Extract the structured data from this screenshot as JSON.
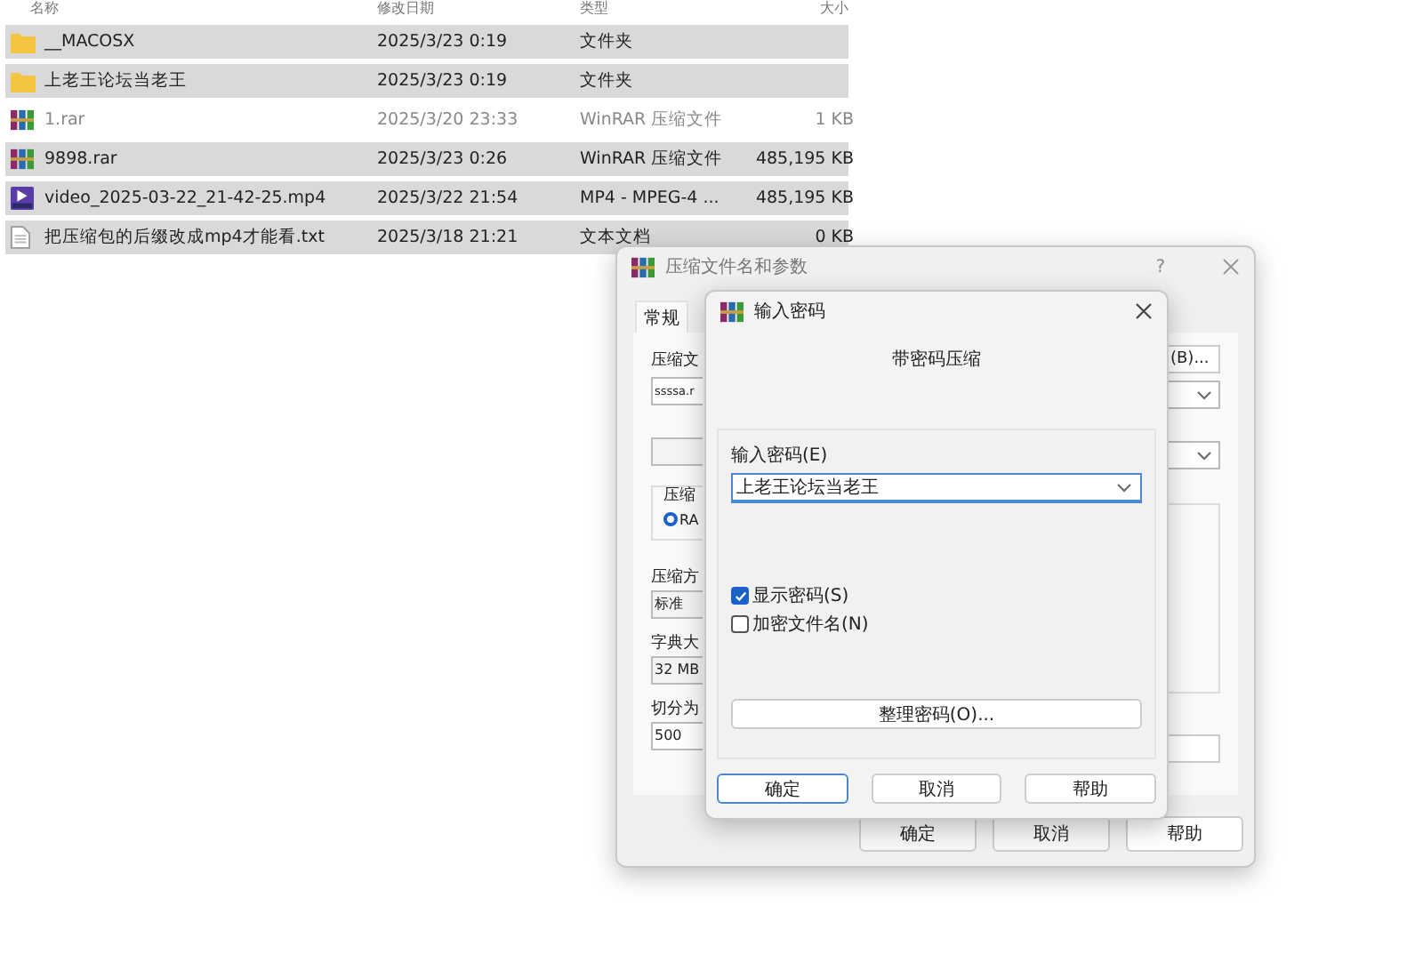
{
  "file_list": {
    "columns": [
      "名称",
      "修改日期",
      "类型",
      "大小"
    ],
    "rows": [
      {
        "kind": "folder",
        "name": "__MACOSX",
        "date": "2025/3/23 0:19",
        "type": "文件夹",
        "selected": true
      },
      {
        "kind": "folder",
        "name": "上老王论坛当老王",
        "date": "2025/3/23 0:19",
        "type": "文件夹",
        "selected": true
      },
      {
        "kind": "archive",
        "name": "1.rar",
        "date": "2025/3/20 23:33",
        "type": "WinRAR 压缩文件",
        "size": "1 KB",
        "selected": false
      },
      {
        "kind": "archive",
        "name": "9898.rar",
        "date": "2025/3/23 0:26",
        "type": "WinRAR 压缩文件",
        "size": "485,195 KB",
        "selected": true
      },
      {
        "kind": "video",
        "name": "video_2025-03-22_21-42-25.mp4",
        "date": "2025/3/22 21:54",
        "type": "MP4 - MPEG-4 ...",
        "size": "485,195 KB",
        "selected": true
      },
      {
        "kind": "text",
        "name": "把压缩包的后缀改成mp4才能看.txt",
        "date": "2025/3/18 21:21",
        "type": "文本文档",
        "size": "0 KB",
        "selected": true
      }
    ]
  },
  "back_dialog": {
    "title": "压缩文件名和参数",
    "help": "?",
    "tabs": [
      {
        "label": "常规",
        "selected": true
      }
    ],
    "archive_name_label": "压缩文",
    "archive_name_value": "ssssa.r",
    "browse_button": "(B)...",
    "format_group_label": "压缩",
    "format_radio": {
      "label": "RA",
      "selected": true
    },
    "method_label": "压缩方",
    "method_value": "标准",
    "dictionary_label": "字典大",
    "dictionary_value": "32 MB",
    "split_label": "切分为",
    "split_value": "500",
    "buttons": [
      "确定",
      "取消",
      "帮助"
    ]
  },
  "front_dialog": {
    "title": "输入密码",
    "heading": "带密码压缩",
    "password_label": "输入密码(E)",
    "password_value": "上老王论坛当老王",
    "options": [
      {
        "label": "显示密码(S)",
        "checked": true
      },
      {
        "label": "加密文件名(N)",
        "checked": false
      }
    ],
    "manage_button": "整理密码(O)...",
    "buttons": [
      {
        "label": "确定",
        "focused": true
      },
      {
        "label": "取消",
        "focused": false
      },
      {
        "label": "帮助",
        "focused": false
      }
    ]
  }
}
